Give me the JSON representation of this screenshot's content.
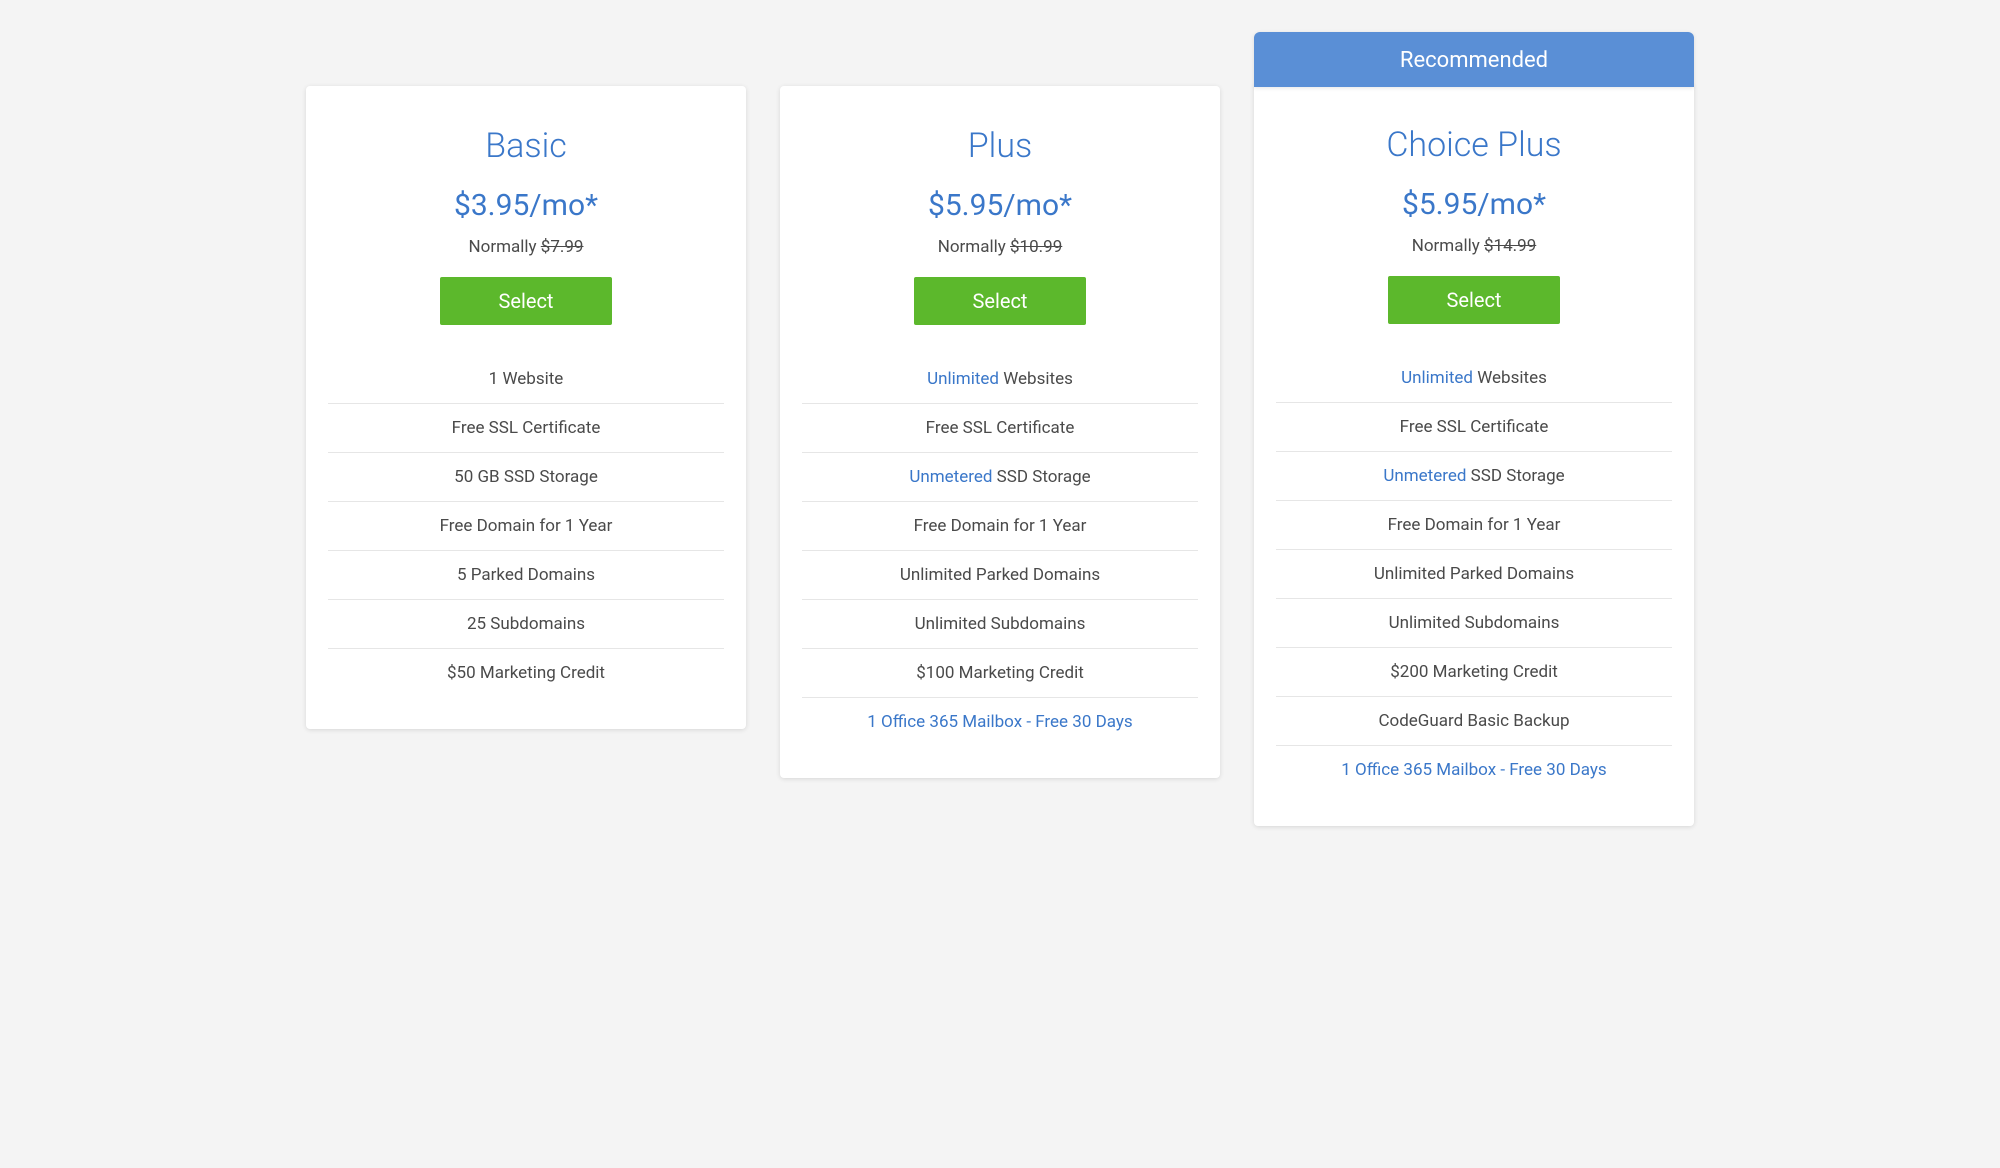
{
  "colors": {
    "accent": "#3a77c9",
    "button": "#5cb82c",
    "badge": "#5a8fd6"
  },
  "select_label": "Select",
  "plans": [
    {
      "id": "basic",
      "badge": "",
      "title": "Basic",
      "price": "$3.95/mo*",
      "normal_prefix": "Normally ",
      "normal_strike": "$7.99",
      "features": [
        {
          "hl": "",
          "rest": "1 Website",
          "link": false
        },
        {
          "hl": "",
          "rest": "Free SSL Certificate",
          "link": false
        },
        {
          "hl": "",
          "rest": "50 GB SSD Storage",
          "link": false
        },
        {
          "hl": "",
          "rest": "Free Domain for 1 Year",
          "link": false
        },
        {
          "hl": "",
          "rest": "5 Parked Domains",
          "link": false
        },
        {
          "hl": "",
          "rest": "25 Subdomains",
          "link": false
        },
        {
          "hl": "",
          "rest": "$50 Marketing Credit",
          "link": false
        }
      ]
    },
    {
      "id": "plus",
      "badge": "",
      "title": "Plus",
      "price": "$5.95/mo*",
      "normal_prefix": "Normally ",
      "normal_strike": "$10.99",
      "features": [
        {
          "hl": "Unlimited",
          "rest": " Websites",
          "link": false
        },
        {
          "hl": "",
          "rest": "Free SSL Certificate",
          "link": false
        },
        {
          "hl": "Unmetered",
          "rest": " SSD Storage",
          "link": false
        },
        {
          "hl": "",
          "rest": "Free Domain for 1 Year",
          "link": false
        },
        {
          "hl": "",
          "rest": "Unlimited Parked Domains",
          "link": false
        },
        {
          "hl": "",
          "rest": "Unlimited Subdomains",
          "link": false
        },
        {
          "hl": "",
          "rest": "$100 Marketing Credit",
          "link": false
        },
        {
          "hl": "",
          "rest": "1 Office 365 Mailbox - Free 30 Days",
          "link": true
        }
      ]
    },
    {
      "id": "choice-plus",
      "badge": "Recommended",
      "title": "Choice Plus",
      "price": "$5.95/mo*",
      "normal_prefix": "Normally ",
      "normal_strike": "$14.99",
      "features": [
        {
          "hl": "Unlimited",
          "rest": " Websites",
          "link": false
        },
        {
          "hl": "",
          "rest": "Free SSL Certificate",
          "link": false
        },
        {
          "hl": "Unmetered",
          "rest": " SSD Storage",
          "link": false
        },
        {
          "hl": "",
          "rest": "Free Domain for 1 Year",
          "link": false
        },
        {
          "hl": "",
          "rest": "Unlimited Parked Domains",
          "link": false
        },
        {
          "hl": "",
          "rest": "Unlimited Subdomains",
          "link": false
        },
        {
          "hl": "",
          "rest": "$200 Marketing Credit",
          "link": false
        },
        {
          "hl": "",
          "rest": "CodeGuard Basic Backup",
          "link": false
        },
        {
          "hl": "",
          "rest": "1 Office 365 Mailbox - Free 30 Days",
          "link": true
        }
      ]
    }
  ]
}
